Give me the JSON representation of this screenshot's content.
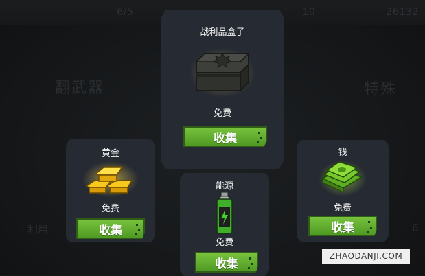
{
  "background": {
    "top_bar": [
      "6/5",
      "10",
      "26132"
    ],
    "left_label": "翻武器",
    "right_label": "特殊",
    "bottom_left": "利用",
    "bottom_right": "6"
  },
  "loot_box": {
    "title": "战利品盒子",
    "price": "免费",
    "button": "收集"
  },
  "gold": {
    "title": "黄金",
    "price": "免费",
    "button": "收集"
  },
  "energy": {
    "title": "能源",
    "price": "免费",
    "button": "收集"
  },
  "money": {
    "title": "钱",
    "price": "免费",
    "button": "收集"
  },
  "watermark": "ZHAODANJI.COM",
  "colors": {
    "panel": "#262b33",
    "button_green": "#6bb332",
    "background": "#151719"
  }
}
